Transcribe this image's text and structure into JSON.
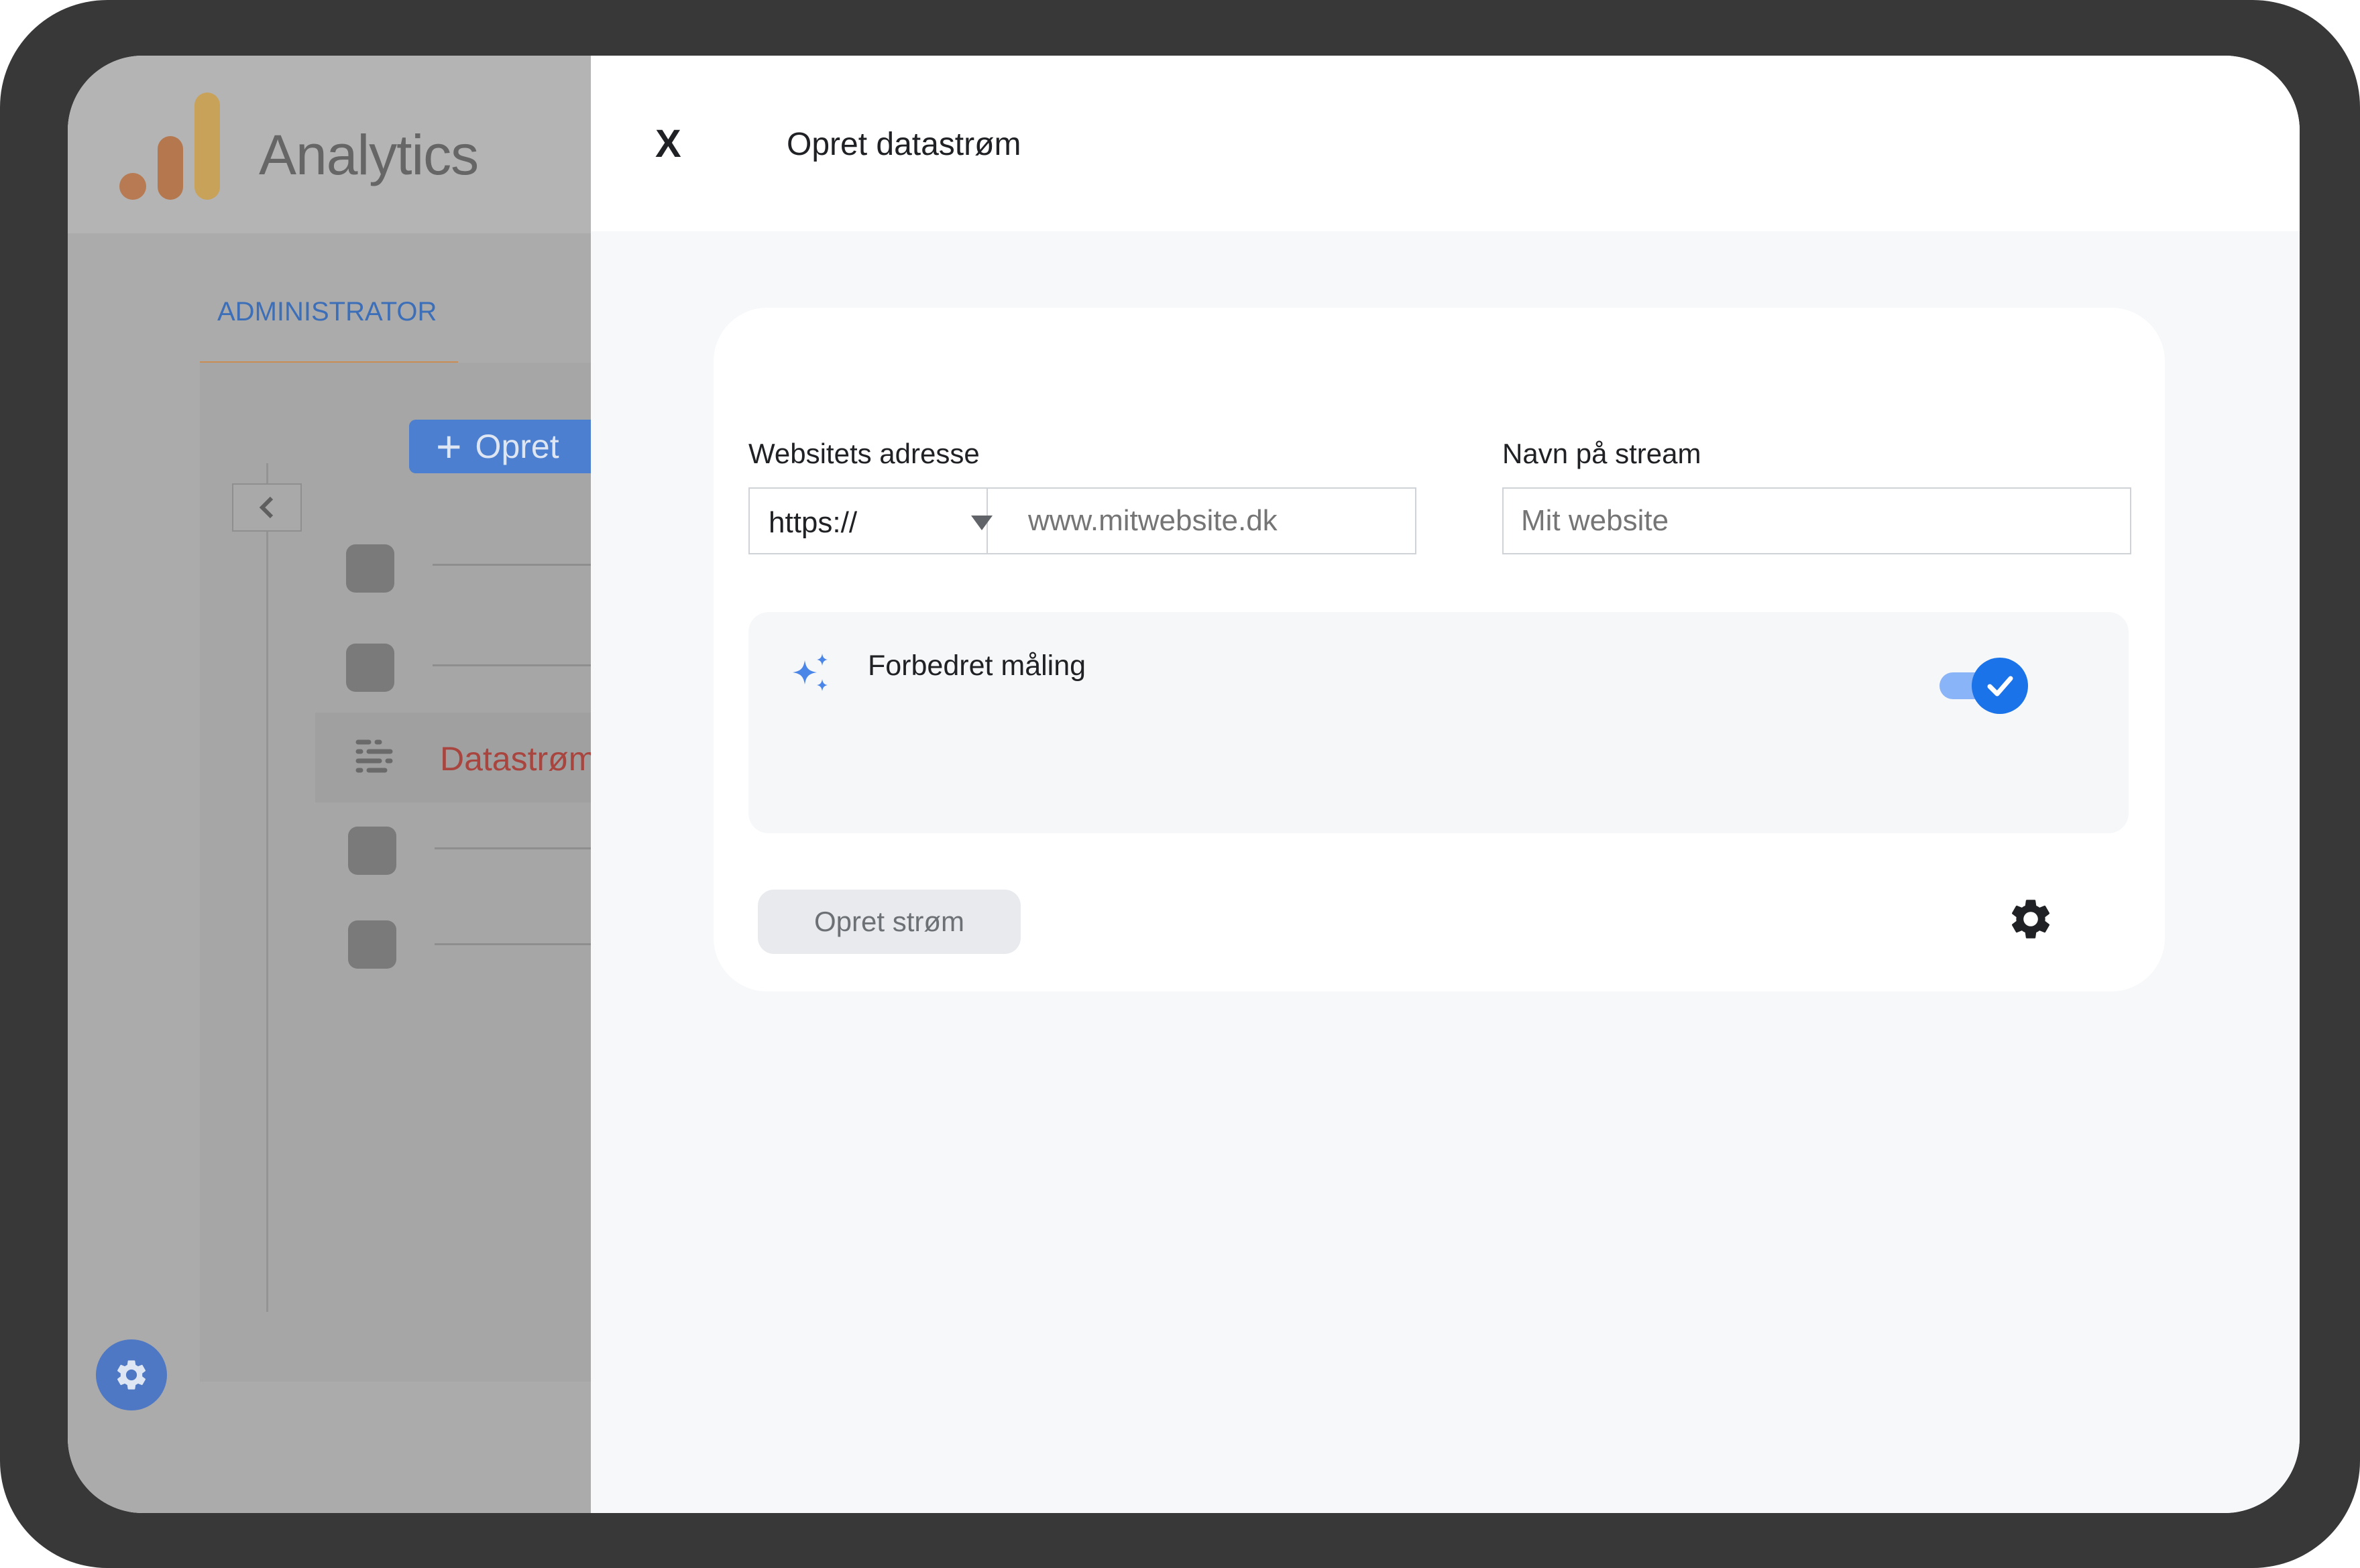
{
  "app": {
    "title": "Analytics",
    "tab_admin": "ADMINISTRATOR",
    "create_button_label": "Opret",
    "active_nav_label": "Datastrøm",
    "logo_colors": [
      "#b77a52",
      "#b4774e",
      "#c9a25a"
    ]
  },
  "panel": {
    "title": "Opret datastrøm",
    "close_label": "X",
    "website_address_label": "Websitets adresse",
    "protocol_value": "https://",
    "url_placeholder": "www.mitwebsite.dk",
    "stream_name_label": "Navn på stream",
    "stream_name_placeholder": "Mit website",
    "enhanced_measurement_label": "Forbedret måling",
    "enhanced_measurement_enabled": true,
    "create_stream_button": "Opret strøm"
  },
  "colors": {
    "accent": "#1a73e8",
    "admin_tab": "#3d6fb8",
    "active_nav": "#a9453f"
  }
}
